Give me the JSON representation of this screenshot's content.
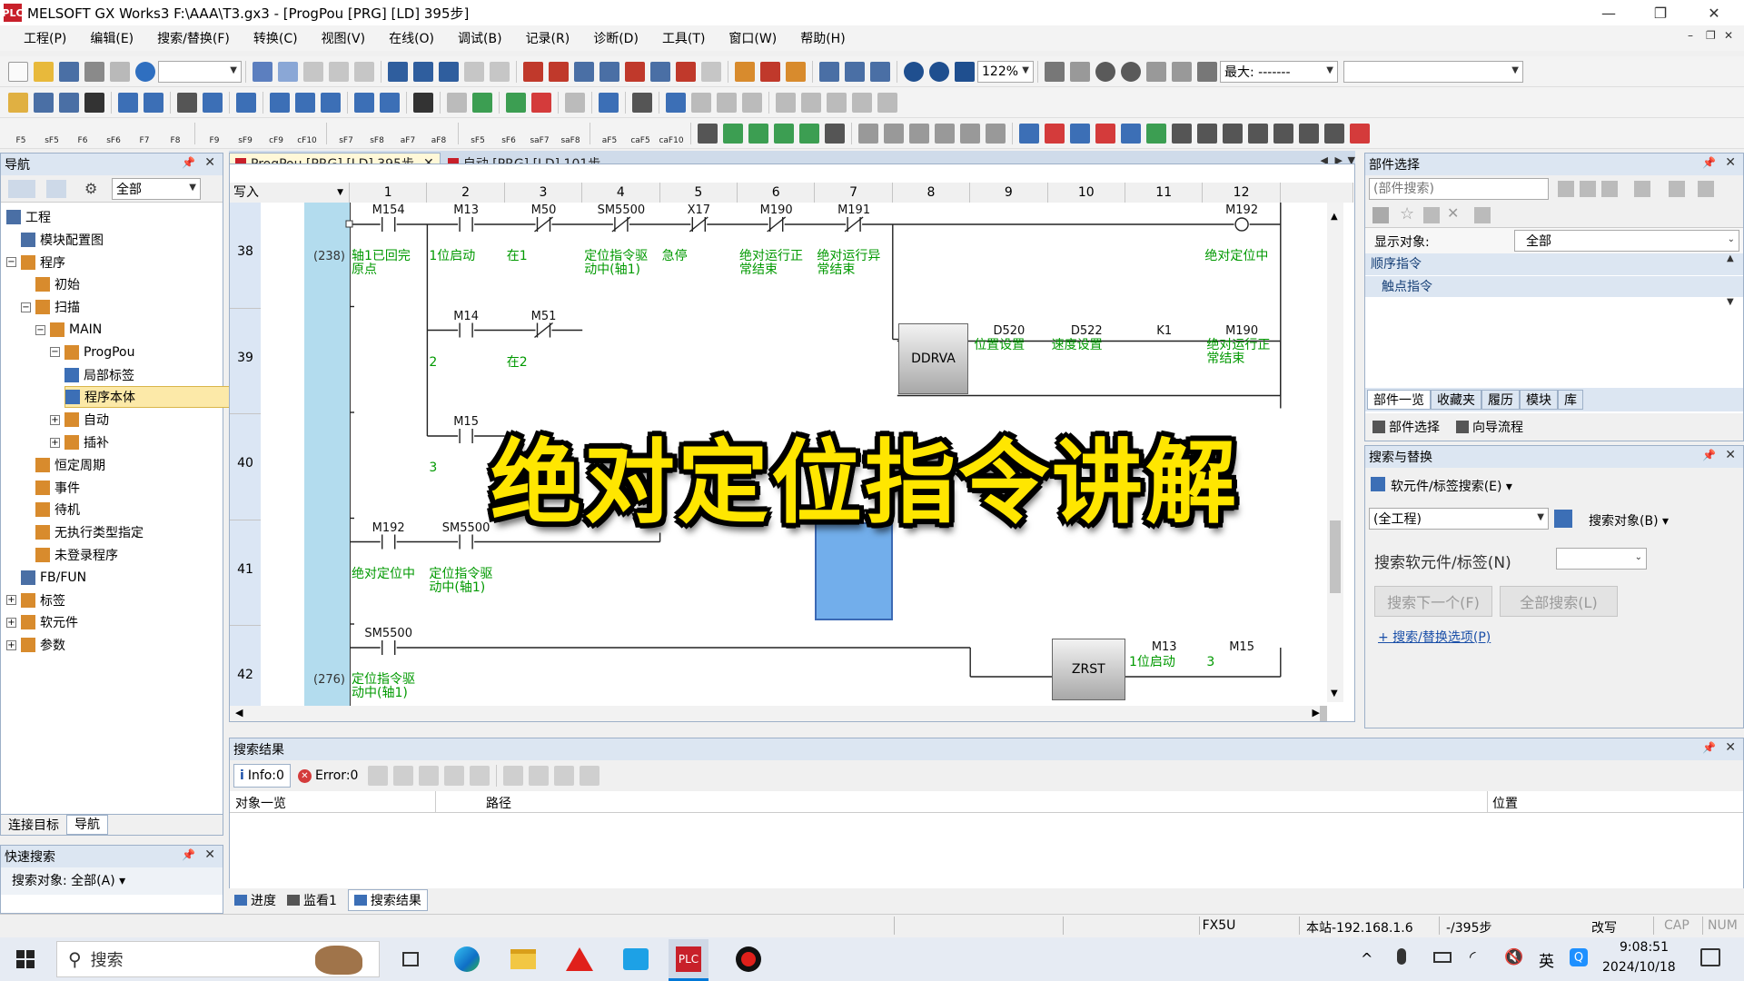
{
  "window": {
    "title": "MELSOFT GX Works3 F:\\AAA\\T3.gx3 - [ProgPou [PRG] [LD] 395步]",
    "app_icon": "PLC",
    "controls": [
      "—",
      "❐",
      "✕"
    ],
    "mdi_controls": [
      "–",
      "❐",
      "✕"
    ]
  },
  "menu": [
    "工程(P)",
    "编辑(E)",
    "搜索/替换(F)",
    "转换(C)",
    "视图(V)",
    "在线(O)",
    "调试(B)",
    "记录(R)",
    "诊断(D)",
    "工具(T)",
    "窗口(W)",
    "帮助(H)"
  ],
  "toolbar": {
    "zoom": "122%",
    "max_label": "最大: -------",
    "fkeys": [
      "F5",
      "sF5",
      "F6",
      "sF6",
      "F7",
      "F8",
      "F9",
      "sF9",
      "cF9",
      "cF10",
      "sF7",
      "sF8",
      "aF7",
      "aF8",
      "sF5",
      "sF6",
      "saF7",
      "saF8",
      "aF5",
      "caF5",
      "caF10"
    ]
  },
  "nav": {
    "title": "导航",
    "filter": "全部",
    "tree": [
      {
        "label": "工程",
        "level": 0,
        "exp": ""
      },
      {
        "label": "模块配置图",
        "level": 1,
        "exp": ""
      },
      {
        "label": "程序",
        "level": 0,
        "exp": "−"
      },
      {
        "label": "初始",
        "level": 2,
        "exp": ""
      },
      {
        "label": "扫描",
        "level": 1,
        "exp": "−"
      },
      {
        "label": "MAIN",
        "level": 2,
        "exp": "−"
      },
      {
        "label": "ProgPou",
        "level": 3,
        "exp": "−"
      },
      {
        "label": "局部标签",
        "level": 4,
        "exp": ""
      },
      {
        "label": "程序本体",
        "level": 4,
        "exp": "",
        "selected": true
      },
      {
        "label": "自动",
        "level": 3,
        "exp": "+"
      },
      {
        "label": "插补",
        "level": 3,
        "exp": "+"
      },
      {
        "label": "恒定周期",
        "level": 2,
        "exp": ""
      },
      {
        "label": "事件",
        "level": 2,
        "exp": ""
      },
      {
        "label": "待机",
        "level": 2,
        "exp": ""
      },
      {
        "label": "无执行类型指定",
        "level": 2,
        "exp": ""
      },
      {
        "label": "未登录程序",
        "level": 2,
        "exp": ""
      },
      {
        "label": "FB/FUN",
        "level": 1,
        "exp": ""
      },
      {
        "label": "标签",
        "level": 0,
        "exp": "+"
      },
      {
        "label": "软元件",
        "level": 0,
        "exp": "+"
      },
      {
        "label": "参数",
        "level": 0,
        "exp": "+"
      }
    ],
    "bottom_tabs": [
      "连接目标",
      "导航"
    ]
  },
  "quick_search": {
    "title": "快速搜索",
    "target": "搜索对象: 全部(A) ▾"
  },
  "editor": {
    "tabs": [
      {
        "label": "ProgPou [PRG] [LD] 395步",
        "active": true
      },
      {
        "label": "自动 [PRG] [LD] 101步",
        "active": false
      }
    ],
    "mode": "写入",
    "columns": [
      "1",
      "2",
      "3",
      "4",
      "5",
      "6",
      "7",
      "8",
      "9",
      "10",
      "11",
      "12"
    ],
    "rows": [
      "38",
      "39",
      "40",
      "41",
      "42"
    ],
    "steps": [
      "(238)",
      "(276)"
    ],
    "contacts": [
      {
        "dev": "M154",
        "cmt": "轴1已回完\n原点"
      },
      {
        "dev": "M13",
        "cmt": "1位启动"
      },
      {
        "dev": "M50",
        "cmt": "在1"
      },
      {
        "dev": "SM5500",
        "cmt": "定位指令驱\n动中(轴1)"
      },
      {
        "dev": "X17",
        "cmt": "急停"
      },
      {
        "dev": "M190",
        "cmt": "绝对运行正\n常结束"
      },
      {
        "dev": "M191",
        "cmt": "绝对运行异\n常结束"
      },
      {
        "dev": "M192",
        "cmt": "绝对定位中"
      },
      {
        "dev": "M14",
        "cmt": "2"
      },
      {
        "dev": "M51",
        "cmt": "在2"
      },
      {
        "dev": "M15",
        "cmt": "3"
      },
      {
        "dev": "M192",
        "cmt": "绝对定位中"
      },
      {
        "dev": "SM5500",
        "cmt": "定位指令驱\n动中(轴1)"
      },
      {
        "dev": "SM5500",
        "cmt": "定位指令驱\n动中(轴1)"
      }
    ],
    "ddrva": {
      "name": "DDRVA",
      "ops": [
        {
          "dev": "D520",
          "cmt": "位置设置"
        },
        {
          "dev": "D522",
          "cmt": "速度设置"
        },
        {
          "dev": "K1",
          "cmt": ""
        },
        {
          "dev": "M190",
          "cmt": "绝对运行正\n常结束"
        }
      ]
    },
    "zrst": {
      "name": "ZRST",
      "ops": [
        {
          "dev": "M13",
          "cmt": "1位启动"
        },
        {
          "dev": "M15",
          "cmt": "3"
        }
      ]
    },
    "overlay": "绝对定位指令讲解"
  },
  "parts": {
    "title": "部件选择",
    "search_placeholder": "(部件搜索)",
    "display_label": "显示对象:",
    "display_value": "全部",
    "list": [
      "顺序指令",
      "触点指令"
    ],
    "tabs": [
      "部件一览",
      "收藏夹",
      "履历",
      "模块",
      "库"
    ],
    "subtabs": [
      "部件选择",
      "向导流程"
    ]
  },
  "search_replace": {
    "title": "搜索与替换",
    "mode": "软元件/标签搜索(E) ▾",
    "scope": "(全工程)",
    "target": "搜索对象(B) ▾",
    "label": "搜索软元件/标签(N)",
    "btn_next": "搜索下一个(F)",
    "btn_all": "全部搜索(L)",
    "options_link": "+ 搜索/替换选项(P)"
  },
  "results": {
    "title": "搜索结果",
    "info": "Info:0",
    "error": "Error:0",
    "columns": [
      "对象一览",
      "路径",
      "位置"
    ],
    "bottom_tabs": [
      "进度",
      "监看1",
      "搜索结果"
    ]
  },
  "status": {
    "model": "FX5U",
    "station": "本站-192.168.1.6",
    "steps": "-/395步",
    "mode": "改写",
    "caps": "CAP",
    "num": "NUM"
  },
  "taskbar": {
    "search": "搜索",
    "ime": "英",
    "time": "9:08:51",
    "date": "2024/10/18"
  },
  "colors": {
    "accent": "#0078d7",
    "comment_green": "#009900",
    "panel_head": "#dce6f2",
    "overlay_yellow": "#ffe600",
    "power_rail": "#b3dcee"
  }
}
